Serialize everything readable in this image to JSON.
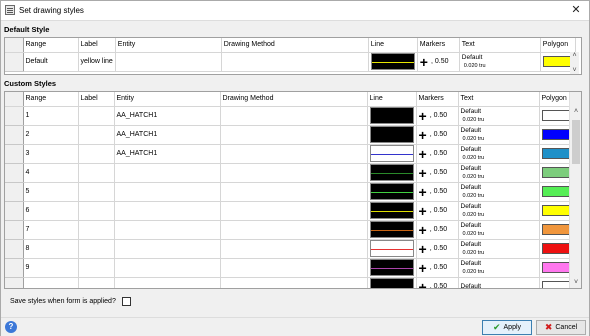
{
  "window": {
    "title": "Set drawing styles",
    "close_glyph": "✕"
  },
  "sections": {
    "default": "Default Style",
    "custom": "Custom Styles"
  },
  "columns": [
    "Range",
    "Label",
    "Entity",
    "Drawing Method",
    "Line",
    "Markers",
    "Text",
    "Polygon"
  ],
  "default_row": {
    "range": "Default",
    "label": "yellow line",
    "entity": "",
    "method": "",
    "line_bg": "#000000",
    "line_color": "#e6e600",
    "marker_glyph": "+",
    "marker_size": ", 0.50",
    "text_font": "Default",
    "text_size": "0.020 tru",
    "polygon_color": "#ffff00"
  },
  "custom_rows": [
    {
      "range": "1",
      "label": "",
      "entity": "AA_HATCH1",
      "method": "",
      "line_bg": "#000000",
      "line_color": "#000000",
      "marker_glyph": "+",
      "marker_size": ", 0.50",
      "text_font": "Default",
      "text_size": "0.020 tru",
      "polygon_color": "#ffffff"
    },
    {
      "range": "2",
      "label": "",
      "entity": "AA_HATCH1",
      "method": "",
      "line_bg": "#000000",
      "line_color": "#000000",
      "marker_glyph": "+",
      "marker_size": ", 0.50",
      "text_font": "Default",
      "text_size": "0.020 tru",
      "polygon_color": "#0000ff"
    },
    {
      "range": "3",
      "label": "",
      "entity": "AA_HATCH1",
      "method": "",
      "line_bg": "#ffffff",
      "line_color": "#3333cc",
      "marker_glyph": "+",
      "marker_size": ", 0.50",
      "text_font": "Default",
      "text_size": "0.020 tru",
      "polygon_color": "#1e90c8"
    },
    {
      "range": "4",
      "label": "",
      "entity": "",
      "method": "",
      "line_bg": "#000000",
      "line_color": "#2a8a2a",
      "marker_glyph": "+",
      "marker_size": ", 0.50",
      "text_font": "Default",
      "text_size": "0.020 tru",
      "polygon_color": "#7ccd7c"
    },
    {
      "range": "5",
      "label": "",
      "entity": "",
      "method": "",
      "line_bg": "#000000",
      "line_color": "#40d040",
      "marker_glyph": "+",
      "marker_size": ", 0.50",
      "text_font": "Default",
      "text_size": "0.020 tru",
      "polygon_color": "#55ee55"
    },
    {
      "range": "6",
      "label": "",
      "entity": "",
      "method": "",
      "line_bg": "#000000",
      "line_color": "#dddd00",
      "marker_glyph": "+",
      "marker_size": ", 0.50",
      "text_font": "Default",
      "text_size": "0.020 tru",
      "polygon_color": "#ffff00"
    },
    {
      "range": "7",
      "label": "",
      "entity": "",
      "method": "",
      "line_bg": "#000000",
      "line_color": "#c86414",
      "marker_glyph": "+",
      "marker_size": ", 0.50",
      "text_font": "Default",
      "text_size": "0.020 tru",
      "polygon_color": "#f0963c"
    },
    {
      "range": "8",
      "label": "",
      "entity": "",
      "method": "",
      "line_bg": "#ffffff",
      "line_color": "#e63232",
      "marker_glyph": "+",
      "marker_size": ", 0.50",
      "text_font": "Default",
      "text_size": "0.020 tru",
      "polygon_color": "#ee1111"
    },
    {
      "range": "9",
      "label": "",
      "entity": "",
      "method": "",
      "line_bg": "#000000",
      "line_color": "#aa44aa",
      "marker_glyph": "+",
      "marker_size": ", 0.50",
      "text_font": "Default",
      "text_size": "0.020 tru",
      "polygon_color": "#ff77ee"
    },
    {
      "range": "",
      "label": "",
      "entity": "",
      "method": "",
      "line_bg": "#000000",
      "line_color": "#000000",
      "marker_glyph": "+",
      "marker_size": ", 0.50",
      "text_font": "Default",
      "text_size": "",
      "polygon_color": "#ffffff"
    }
  ],
  "save_styles_label": "Save styles when form is applied?",
  "save_styles_checked": false,
  "buttons": {
    "help": "?",
    "apply": "Apply",
    "cancel": "Cancel"
  }
}
